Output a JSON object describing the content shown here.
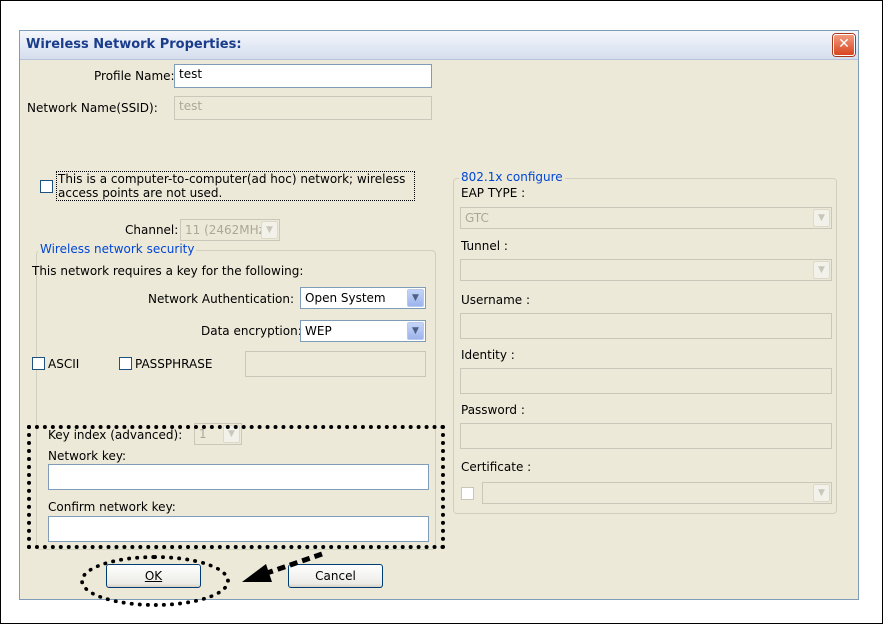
{
  "dialog": {
    "title": "Wireless Network Properties:",
    "close_glyph": "✕"
  },
  "profile": {
    "profile_name_label": "Profile Name:",
    "profile_name_value": "test",
    "ssid_label": "Network Name(SSID):",
    "ssid_value": "test"
  },
  "adhoc": {
    "line1": "This is a computer-to-computer(ad hoc) network; wireless",
    "line2": "access points are not used.",
    "checked": false
  },
  "channel": {
    "label": "Channel:",
    "value": "11 (2462MHz)"
  },
  "security": {
    "group_title": "Wireless network security",
    "requires_text": "This network requires a key for the following:",
    "auth_label": "Network Authentication:",
    "auth_value": "Open System",
    "enc_label": "Data encryption:",
    "enc_value": "WEP",
    "ascii_label": "ASCII",
    "passphrase_label": "PASSPHRASE",
    "passphrase_value": "",
    "key_index_label": "Key index (advanced):",
    "key_index_value": "1",
    "network_key_label": "Network key:",
    "network_key_value": "",
    "confirm_key_label": "Confirm network key:",
    "confirm_key_value": ""
  },
  "eap": {
    "group_title": "802.1x configure",
    "eap_type_label": "EAP TYPE :",
    "eap_type_value": "GTC",
    "tunnel_label": "Tunnel :",
    "tunnel_value": "",
    "username_label": "Username :",
    "username_value": "",
    "identity_label": "Identity :",
    "identity_value": "",
    "password_label": "Password :",
    "password_value": "",
    "certificate_label": "Certificate :",
    "certificate_value": ""
  },
  "buttons": {
    "ok_label": "OK",
    "cancel_label": "Cancel"
  },
  "icons": {
    "dropdown_arrow": "▼",
    "annotation_arrow": "dashed-arrow-left"
  },
  "colors": {
    "window_bg": "#ece9d8",
    "title_text": "#1a3c8a",
    "group_legend": "#0046d5",
    "close_button": "#d8451f"
  }
}
